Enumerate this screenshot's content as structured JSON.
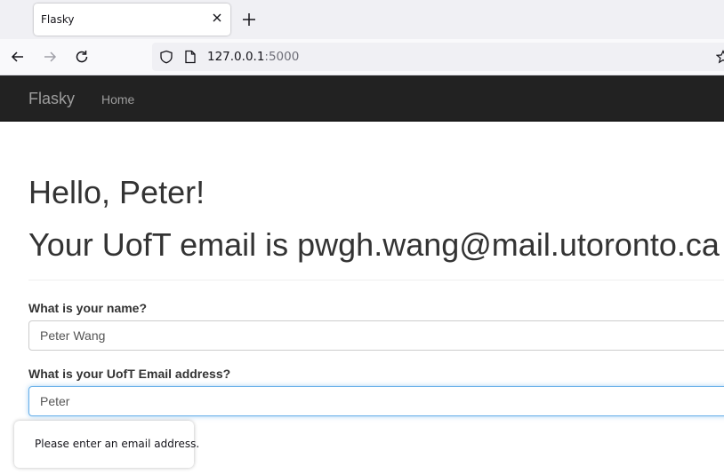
{
  "browser": {
    "tab": {
      "title": "Flasky"
    },
    "url": {
      "host": "127.0.0.1",
      "port": ":5000"
    },
    "icons": {
      "back": "back-arrow-icon",
      "forward": "forward-arrow-icon",
      "reload": "reload-icon",
      "shield": "tracking-protection-shield-icon",
      "page": "page-info-icon",
      "star": "bookmark-star-icon",
      "close": "close-icon",
      "new_tab": "plus-icon"
    }
  },
  "app_nav": {
    "brand": "Flasky",
    "links": [
      "Home"
    ],
    "background": "#222222"
  },
  "main": {
    "greeting": "Hello, Peter!",
    "email_message": "Your UofT email is pwgh.wang@mail.utoronto.ca",
    "form": {
      "name_label": "What is your name?",
      "name_value": "Peter Wang",
      "email_label": "What is your UofT Email address?",
      "email_value": "Peter"
    },
    "validation_tooltip": "Please enter an email address."
  },
  "colors": {
    "focus_border": "#66afe9",
    "text": "#333333"
  }
}
